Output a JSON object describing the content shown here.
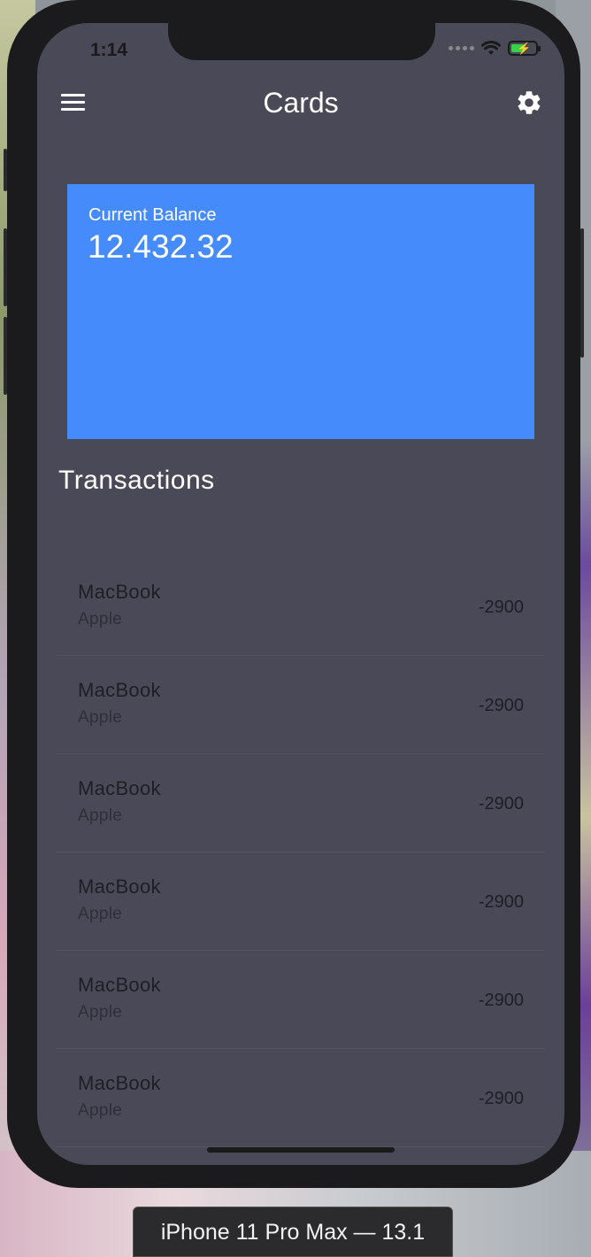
{
  "status_bar": {
    "time": "1:14"
  },
  "header": {
    "title": "Cards",
    "menu_icon": "hamburger-menu-icon",
    "settings_icon": "gear-icon"
  },
  "balance_card": {
    "label": "Current Balance",
    "value": "12.432.32",
    "color": "#468bfb"
  },
  "transactions": {
    "title": "Transactions",
    "items": [
      {
        "name": "MacBook",
        "merchant": "Apple",
        "amount": "-2900"
      },
      {
        "name": "MacBook",
        "merchant": "Apple",
        "amount": "-2900"
      },
      {
        "name": "MacBook",
        "merchant": "Apple",
        "amount": "-2900"
      },
      {
        "name": "MacBook",
        "merchant": "Apple",
        "amount": "-2900"
      },
      {
        "name": "MacBook",
        "merchant": "Apple",
        "amount": "-2900"
      },
      {
        "name": "MacBook",
        "merchant": "Apple",
        "amount": "-2900"
      }
    ]
  },
  "device": {
    "label": "iPhone 11 Pro Max — 13.1"
  },
  "colors": {
    "screen_background": "#4a4957",
    "accent": "#468bfb"
  }
}
